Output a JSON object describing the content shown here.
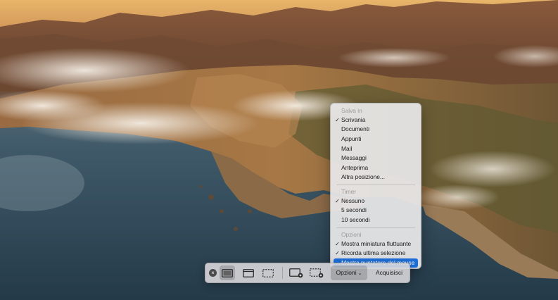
{
  "colors": {
    "selection": "#1d6ed8",
    "menu_background": "#e8e8ea",
    "toolbar_background": "#d7d7da"
  },
  "menu": {
    "save_section": {
      "header": "Salva in",
      "items": [
        {
          "label": "Scrivania",
          "checked": true
        },
        {
          "label": "Documenti",
          "checked": false
        },
        {
          "label": "Appunti",
          "checked": false
        },
        {
          "label": "Mail",
          "checked": false
        },
        {
          "label": "Messaggi",
          "checked": false
        },
        {
          "label": "Anteprima",
          "checked": false
        },
        {
          "label": "Altra posizione...",
          "checked": false
        }
      ]
    },
    "timer_section": {
      "header": "Timer",
      "items": [
        {
          "label": "Nessuno",
          "checked": true
        },
        {
          "label": "5 secondi",
          "checked": false
        },
        {
          "label": "10 secondi",
          "checked": false
        }
      ]
    },
    "options_section": {
      "header": "Opzioni",
      "items": [
        {
          "label": "Mostra miniatura fluttuante",
          "checked": true
        },
        {
          "label": "Ricorda ultima selezione",
          "checked": true
        },
        {
          "label": "Mostra puntatore del mouse",
          "checked": false,
          "highlighted": true
        }
      ]
    }
  },
  "toolbar": {
    "close_icon": "x-circle-icon",
    "tools": [
      {
        "icon": "capture-entire-screen-icon",
        "active": true
      },
      {
        "icon": "capture-window-icon",
        "active": false
      },
      {
        "icon": "capture-selection-icon",
        "active": false
      },
      {
        "icon": "record-entire-screen-icon",
        "active": false
      },
      {
        "icon": "record-selection-icon",
        "active": false
      }
    ],
    "options_label": "Opzioni",
    "options_chevron": "chevron-down-icon",
    "capture_label": "Acquisisci"
  }
}
